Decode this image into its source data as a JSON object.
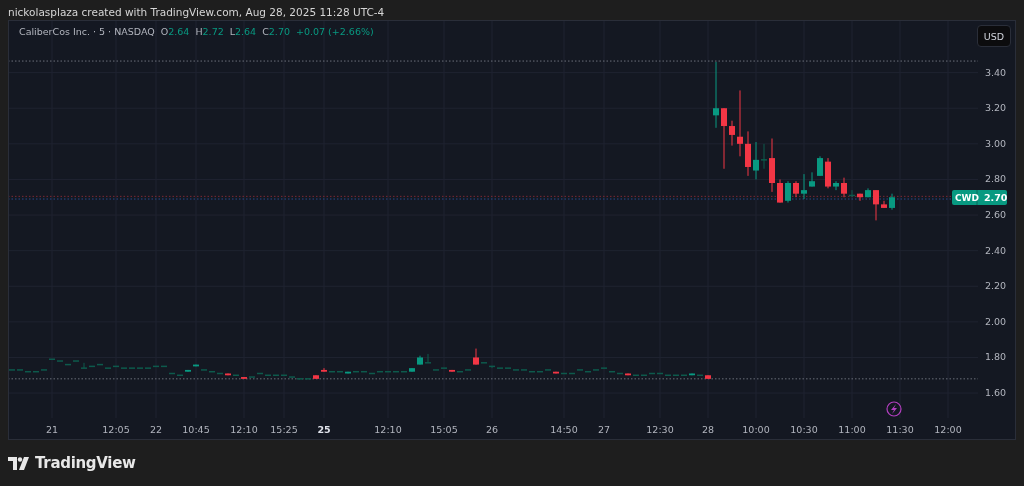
{
  "header": {
    "caption": "nickolasplaza created with TradingView.com, Aug 28, 2025 11:28 UTC-4"
  },
  "legend": {
    "symbol": "CaliberCos Inc. · 5 · NASDAQ",
    "fields": [
      {
        "label": "O",
        "value": "2.64"
      },
      {
        "label": "H",
        "value": "2.72"
      },
      {
        "label": "L",
        "value": "2.64"
      },
      {
        "label": "C",
        "value": "2.70"
      }
    ],
    "change": "+0.07 (+2.66%)"
  },
  "currency_button": "USD",
  "price_tag": {
    "ticker": "CWD",
    "price": "2.70"
  },
  "chart_data": {
    "type": "candlestick",
    "categories": [
      null,
      null,
      null,
      null,
      null,
      "21",
      null,
      null,
      null,
      null,
      null,
      null,
      null,
      "12:05",
      null,
      null,
      null,
      null,
      "22",
      null,
      null,
      null,
      null,
      "10:45",
      null,
      null,
      null,
      null,
      null,
      "12:10",
      null,
      null,
      null,
      null,
      "15:25",
      null,
      null,
      null,
      null,
      "25",
      null,
      null,
      null,
      null,
      null,
      null,
      null,
      "12:10",
      null,
      null,
      null,
      null,
      null,
      null,
      "15:05",
      null,
      null,
      null,
      null,
      null,
      "26",
      null,
      null,
      null,
      null,
      null,
      null,
      null,
      null,
      "14:50",
      null,
      null,
      null,
      null,
      "27",
      null,
      null,
      null,
      null,
      null,
      null,
      "12:30",
      null,
      null,
      null,
      null,
      null,
      "28",
      null,
      null,
      null,
      null,
      null,
      "10:00",
      null,
      null,
      null,
      null,
      null,
      "10:30",
      null,
      null,
      null,
      null,
      null,
      "11:00",
      null,
      null,
      null,
      null,
      null,
      "11:30",
      null,
      null,
      null,
      null,
      null,
      "12:00",
      null,
      null,
      null
    ],
    "ylim": [
      1.46,
      3.69
    ],
    "ohlc": [
      [
        1.73,
        1.73,
        1.73,
        1.73
      ],
      [
        1.73,
        1.73,
        1.73,
        1.73
      ],
      [
        1.72,
        1.72,
        1.72,
        1.72
      ],
      [
        1.72,
        1.72,
        1.72,
        1.72
      ],
      [
        1.73,
        1.73,
        1.73,
        1.73
      ],
      [
        1.79,
        1.79,
        1.79,
        1.79
      ],
      [
        1.78,
        1.78,
        1.78,
        1.78
      ],
      [
        1.76,
        1.76,
        1.76,
        1.76
      ],
      [
        1.78,
        1.78,
        1.78,
        1.78
      ],
      [
        1.74,
        1.77,
        1.74,
        1.74
      ],
      [
        1.75,
        1.75,
        1.75,
        1.75
      ],
      [
        1.76,
        1.76,
        1.76,
        1.76
      ],
      [
        1.74,
        1.74,
        1.74,
        1.74
      ],
      [
        1.75,
        1.75,
        1.75,
        1.75
      ],
      [
        1.74,
        1.74,
        1.74,
        1.74
      ],
      [
        1.74,
        1.74,
        1.74,
        1.74
      ],
      [
        1.74,
        1.74,
        1.74,
        1.74
      ],
      [
        1.74,
        1.74,
        1.74,
        1.74
      ],
      [
        1.75,
        1.75,
        1.75,
        1.75
      ],
      [
        1.75,
        1.75,
        1.75,
        1.75
      ],
      [
        1.71,
        1.71,
        1.71,
        1.71
      ],
      [
        1.7,
        1.7,
        1.7,
        1.7
      ],
      [
        1.72,
        1.73,
        1.72,
        1.73
      ],
      [
        1.75,
        1.76,
        1.75,
        1.76
      ],
      [
        1.73,
        1.73,
        1.73,
        1.73
      ],
      [
        1.72,
        1.72,
        1.72,
        1.72
      ],
      [
        1.71,
        1.71,
        1.71,
        1.71
      ],
      [
        1.71,
        1.71,
        1.7,
        1.7
      ],
      [
        1.7,
        1.7,
        1.7,
        1.7
      ],
      [
        1.69,
        1.69,
        1.68,
        1.68
      ],
      [
        1.69,
        1.69,
        1.69,
        1.69
      ],
      [
        1.71,
        1.71,
        1.71,
        1.71
      ],
      [
        1.7,
        1.7,
        1.7,
        1.7
      ],
      [
        1.7,
        1.7,
        1.7,
        1.7
      ],
      [
        1.7,
        1.7,
        1.7,
        1.7
      ],
      [
        1.69,
        1.69,
        1.69,
        1.69
      ],
      [
        1.68,
        1.68,
        1.68,
        1.68
      ],
      [
        1.68,
        1.68,
        1.68,
        1.68
      ],
      [
        1.7,
        1.7,
        1.68,
        1.68
      ],
      [
        1.73,
        1.74,
        1.72,
        1.72
      ],
      [
        1.72,
        1.72,
        1.72,
        1.72
      ],
      [
        1.72,
        1.72,
        1.72,
        1.72
      ],
      [
        1.71,
        1.72,
        1.71,
        1.72
      ],
      [
        1.72,
        1.72,
        1.72,
        1.72
      ],
      [
        1.72,
        1.72,
        1.72,
        1.72
      ],
      [
        1.71,
        1.71,
        1.71,
        1.71
      ],
      [
        1.72,
        1.72,
        1.72,
        1.72
      ],
      [
        1.72,
        1.72,
        1.72,
        1.72
      ],
      [
        1.72,
        1.72,
        1.72,
        1.72
      ],
      [
        1.72,
        1.72,
        1.72,
        1.72
      ],
      [
        1.72,
        1.74,
        1.72,
        1.74
      ],
      [
        1.76,
        1.81,
        1.76,
        1.8
      ],
      [
        1.77,
        1.82,
        1.77,
        1.77
      ],
      [
        1.73,
        1.73,
        1.73,
        1.73
      ],
      [
        1.74,
        1.74,
        1.74,
        1.74
      ],
      [
        1.73,
        1.73,
        1.72,
        1.72
      ],
      [
        1.72,
        1.72,
        1.72,
        1.72
      ],
      [
        1.73,
        1.73,
        1.73,
        1.73
      ],
      [
        1.8,
        1.85,
        1.76,
        1.76
      ],
      [
        1.77,
        1.77,
        1.77,
        1.77
      ],
      [
        1.75,
        1.75,
        1.74,
        1.75
      ],
      [
        1.74,
        1.74,
        1.74,
        1.74
      ],
      [
        1.74,
        1.74,
        1.74,
        1.74
      ],
      [
        1.73,
        1.73,
        1.73,
        1.73
      ],
      [
        1.73,
        1.73,
        1.73,
        1.73
      ],
      [
        1.72,
        1.72,
        1.72,
        1.72
      ],
      [
        1.72,
        1.72,
        1.72,
        1.72
      ],
      [
        1.73,
        1.73,
        1.73,
        1.73
      ],
      [
        1.72,
        1.72,
        1.71,
        1.71
      ],
      [
        1.71,
        1.71,
        1.71,
        1.71
      ],
      [
        1.71,
        1.71,
        1.71,
        1.71
      ],
      [
        1.73,
        1.73,
        1.73,
        1.73
      ],
      [
        1.72,
        1.72,
        1.72,
        1.72
      ],
      [
        1.73,
        1.73,
        1.73,
        1.73
      ],
      [
        1.74,
        1.74,
        1.74,
        1.74
      ],
      [
        1.72,
        1.72,
        1.72,
        1.72
      ],
      [
        1.71,
        1.71,
        1.71,
        1.71
      ],
      [
        1.71,
        1.71,
        1.7,
        1.7
      ],
      [
        1.7,
        1.7,
        1.7,
        1.7
      ],
      [
        1.7,
        1.7,
        1.7,
        1.7
      ],
      [
        1.71,
        1.71,
        1.71,
        1.71
      ],
      [
        1.71,
        1.71,
        1.71,
        1.71
      ],
      [
        1.7,
        1.7,
        1.7,
        1.7
      ],
      [
        1.7,
        1.7,
        1.7,
        1.7
      ],
      [
        1.7,
        1.7,
        1.7,
        1.7
      ],
      [
        1.7,
        1.71,
        1.7,
        1.71
      ],
      [
        1.7,
        1.7,
        1.7,
        1.7
      ],
      [
        1.7,
        1.7,
        1.68,
        1.68
      ],
      [
        3.16,
        3.46,
        3.09,
        3.2
      ],
      [
        3.2,
        3.2,
        2.86,
        3.1
      ],
      [
        3.1,
        3.13,
        2.99,
        3.05
      ],
      [
        3.04,
        3.3,
        2.93,
        3.0
      ],
      [
        3.0,
        3.07,
        2.82,
        2.87
      ],
      [
        2.85,
        3.01,
        2.8,
        2.91
      ],
      [
        2.91,
        3.0,
        2.86,
        2.91
      ],
      [
        2.92,
        3.03,
        2.73,
        2.78
      ],
      [
        2.78,
        2.8,
        2.67,
        2.67
      ],
      [
        2.68,
        2.79,
        2.67,
        2.78
      ],
      [
        2.78,
        2.79,
        2.7,
        2.72
      ],
      [
        2.72,
        2.83,
        2.69,
        2.74
      ],
      [
        2.76,
        2.84,
        2.76,
        2.79
      ],
      [
        2.82,
        2.93,
        2.82,
        2.92
      ],
      [
        2.9,
        2.92,
        2.75,
        2.76
      ],
      [
        2.76,
        2.79,
        2.74,
        2.78
      ],
      [
        2.78,
        2.81,
        2.7,
        2.72
      ],
      [
        2.71,
        2.74,
        2.7,
        2.71
      ],
      [
        2.72,
        2.72,
        2.68,
        2.7
      ],
      [
        2.7,
        2.75,
        2.7,
        2.74
      ],
      [
        2.74,
        2.74,
        2.57,
        2.66
      ],
      [
        2.66,
        2.68,
        2.64,
        2.64
      ],
      [
        2.64,
        2.72,
        2.63,
        2.7
      ],
      null,
      null,
      null,
      null,
      null,
      null,
      null,
      null,
      null,
      null
    ],
    "yticks": [
      {
        "value": 3.4,
        "label": "3.40"
      },
      {
        "value": 3.2,
        "label": "3.20"
      },
      {
        "value": 3.0,
        "label": "3.00"
      },
      {
        "value": 2.8,
        "label": "2.80"
      },
      {
        "value": 2.6,
        "label": "2.60"
      },
      {
        "value": 2.4,
        "label": "2.40"
      },
      {
        "value": 2.2,
        "label": "2.20"
      },
      {
        "value": 2.0,
        "label": "2.00"
      },
      {
        "value": 1.8,
        "label": "1.80"
      },
      {
        "value": 1.6,
        "label": "1.60"
      }
    ],
    "grid": true,
    "ref_lines": [
      {
        "axis": "y",
        "value": 3.465,
        "color": "#6b6f7a"
      },
      {
        "axis": "y",
        "value": 1.68,
        "color": "#6b6f7a"
      },
      {
        "axis": "y",
        "value": 2.705,
        "color": "#7a2a35"
      },
      {
        "axis": "y",
        "value": 2.69,
        "color": "#2a4a8a"
      }
    ]
  },
  "emphasized_ticks": [
    {
      "emphasized": false
    },
    {
      "emphasized": false
    },
    {
      "emphasized": false
    },
    {
      "emphasized": false
    },
    {
      "emphasized": false
    },
    {
      "emphasized": false
    },
    {
      "emphasized": true
    },
    {
      "emphasized": false
    },
    {
      "emphasized": false
    },
    {
      "emphasized": false
    },
    {
      "emphasized": false
    },
    {
      "emphasized": false
    },
    {
      "emphasized": false
    },
    {
      "emphasized": false
    },
    {
      "emphasized": false
    },
    {
      "emphasized": false
    },
    {
      "emphasized": false
    },
    {
      "emphasized": false
    },
    {
      "emphasized": false
    }
  ],
  "footer": {
    "brand": "TradingView"
  }
}
